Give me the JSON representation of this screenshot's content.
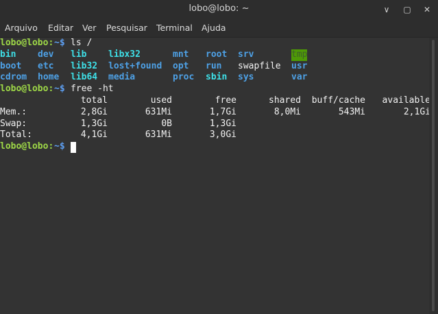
{
  "window": {
    "title": "lobo@lobo: ~",
    "minimize_icon": "∨",
    "maximize_icon": "▢",
    "close_icon": "✕"
  },
  "menu": [
    "Arquivo",
    "Editar",
    "Ver",
    "Pesquisar",
    "Terminal",
    "Ajuda"
  ],
  "colors": {
    "prompt_user": "#9ed847",
    "prompt_path": "#5d9ef0",
    "directory": "#4ea1e6",
    "symlink": "#3ee0e8",
    "tmp_bg": "#4e9a06",
    "background": "#333333"
  },
  "terminal": {
    "prompt_user": "lobo@lobo:",
    "prompt_path": "~$",
    "cmd1": "ls /",
    "ls": {
      "r1": [
        "bin",
        "dev",
        "lib",
        "libx32",
        "mnt",
        "root",
        "srv",
        "tmp"
      ],
      "r2": [
        "boot",
        "etc",
        "lib32",
        "lost+found",
        "opt",
        "run",
        "swapfile",
        "usr"
      ],
      "r3": [
        "cdrom",
        "home",
        "lib64",
        "media",
        "proc",
        "sbin",
        "sys",
        "var"
      ]
    },
    "cmd2": "free -ht",
    "free": {
      "headers": [
        "total",
        "used",
        "free",
        "shared",
        "buff/cache",
        "available"
      ],
      "mem": [
        "Mem.:",
        "2,8Gi",
        "631Mi",
        "1,7Gi",
        "8,0Mi",
        "543Mi",
        "2,1Gi"
      ],
      "swap": [
        "Swap:",
        "1,3Gi",
        "0B",
        "1,3Gi"
      ],
      "total": [
        "Total:",
        "4,1Gi",
        "631Mi",
        "3,0Gi"
      ]
    }
  }
}
